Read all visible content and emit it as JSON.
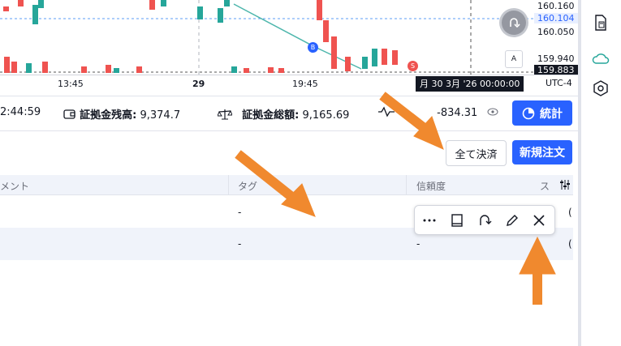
{
  "chart": {
    "price_labels": [
      "160.160",
      "160.104",
      "160.050",
      "159.940",
      "159.883"
    ],
    "current_price": "160.104",
    "last_price": "159.883",
    "time_labels": [
      "13:45",
      "29",
      "19:45"
    ],
    "crosshair_date": "月 30 3月 '26 00:00:00",
    "timezone": "UTC-4",
    "buy_marker": "B",
    "sell_marker": "S",
    "auto_scale": "A"
  },
  "account": {
    "time_fragment": "2:44:59",
    "margin_balance_label": "証拠金残高:",
    "margin_balance_value": "9,374.7",
    "total_margin_label": "証拠金総額:",
    "total_margin_value": "9,165.69",
    "pnl_value": "-834.31",
    "stats_button": "統計"
  },
  "actions": {
    "close_all": "全て決済",
    "new_order": "新規注文"
  },
  "table": {
    "headers": [
      "メント",
      "タグ",
      "信頼度",
      "ス"
    ],
    "rows": [
      {
        "tag": "-",
        "confidence": "",
        "extra": "("
      },
      {
        "tag": "-",
        "confidence": "-",
        "extra": "("
      }
    ]
  },
  "colors": {
    "accent": "#2962ff",
    "up": "#26a69a",
    "down": "#ef5350",
    "arrow": "#f0892e"
  }
}
